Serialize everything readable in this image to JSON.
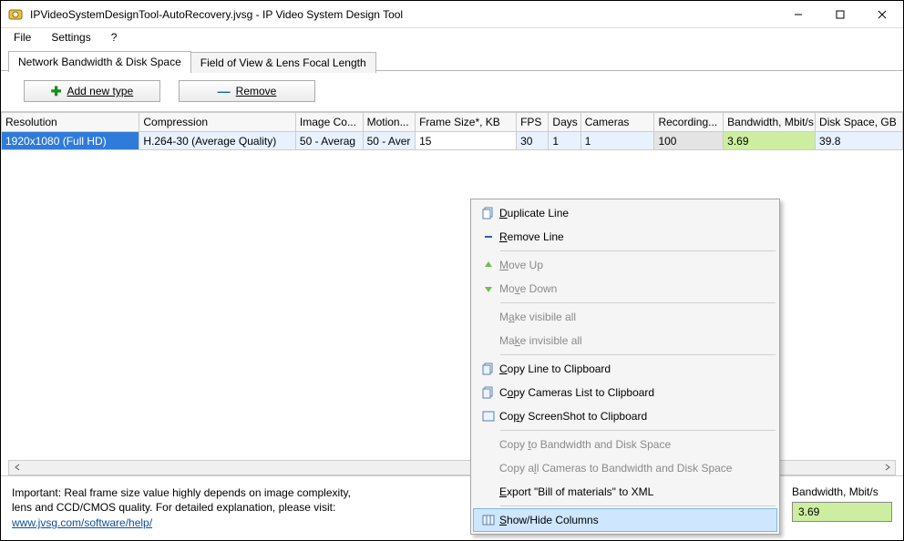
{
  "window": {
    "title": "IPVideoSystemDesignTool-AutoRecovery.jvsg - IP Video System Design Tool"
  },
  "menu": {
    "file": "File",
    "settings": "Settings",
    "help": "?"
  },
  "tabs": {
    "t0": "Network Bandwidth & Disk Space",
    "t1": "Field of View & Lens Focal Length"
  },
  "toolbar": {
    "add": "Add new type",
    "remove": "Remove"
  },
  "columns": {
    "resolution": "Resolution",
    "compression": "Compression",
    "imageco": "Image Co...",
    "motion": "Motion...",
    "framesize": "Frame Size*, KB",
    "fps": "FPS",
    "days": "Days",
    "cameras": "Cameras",
    "recording": "Recording...",
    "bandwidth": "Bandwidth, Mbit/s",
    "diskspace": "Disk Space, GB"
  },
  "rows": [
    {
      "resolution": "1920x1080 (Full HD)",
      "compression": "H.264-30 (Average Quality)",
      "imageco": "50 - Averag",
      "motion": "50 - Aver",
      "framesize": "15",
      "fps": "30",
      "days": "1",
      "cameras": "1",
      "recording": "100",
      "bandwidth": "3.69",
      "diskspace": "39.8"
    }
  ],
  "context_menu": {
    "duplicate": "Duplicate Line",
    "remove": "Remove Line",
    "moveup": "Move Up",
    "movedown": "Move Down",
    "visible_all": "Make visibile all",
    "invisible_all": "Make invisible all",
    "copy_line": "Copy Line to Clipboard",
    "copy_cams": "Copy Cameras List to Clipboard",
    "copy_shot": "Copy ScreenShot to Clipboard",
    "copy_bw": "Copy to Bandwidth and Disk Space",
    "copy_all_bw": "Copy all Cameras to Bandwidth and Disk Space",
    "export_bom": "Export \"Bill of materials\" to XML",
    "showhide": "Show/Hide Columns"
  },
  "footer": {
    "note1": "Important: Real frame size value highly depends on image complexity,",
    "note2": "lens and CCD/CMOS quality. For detailed explanation, please visit:",
    "link": "www.jvsg.com/software/help/",
    "readout_label": "Bandwidth, Mbit/s",
    "readout_value": "3.69"
  }
}
